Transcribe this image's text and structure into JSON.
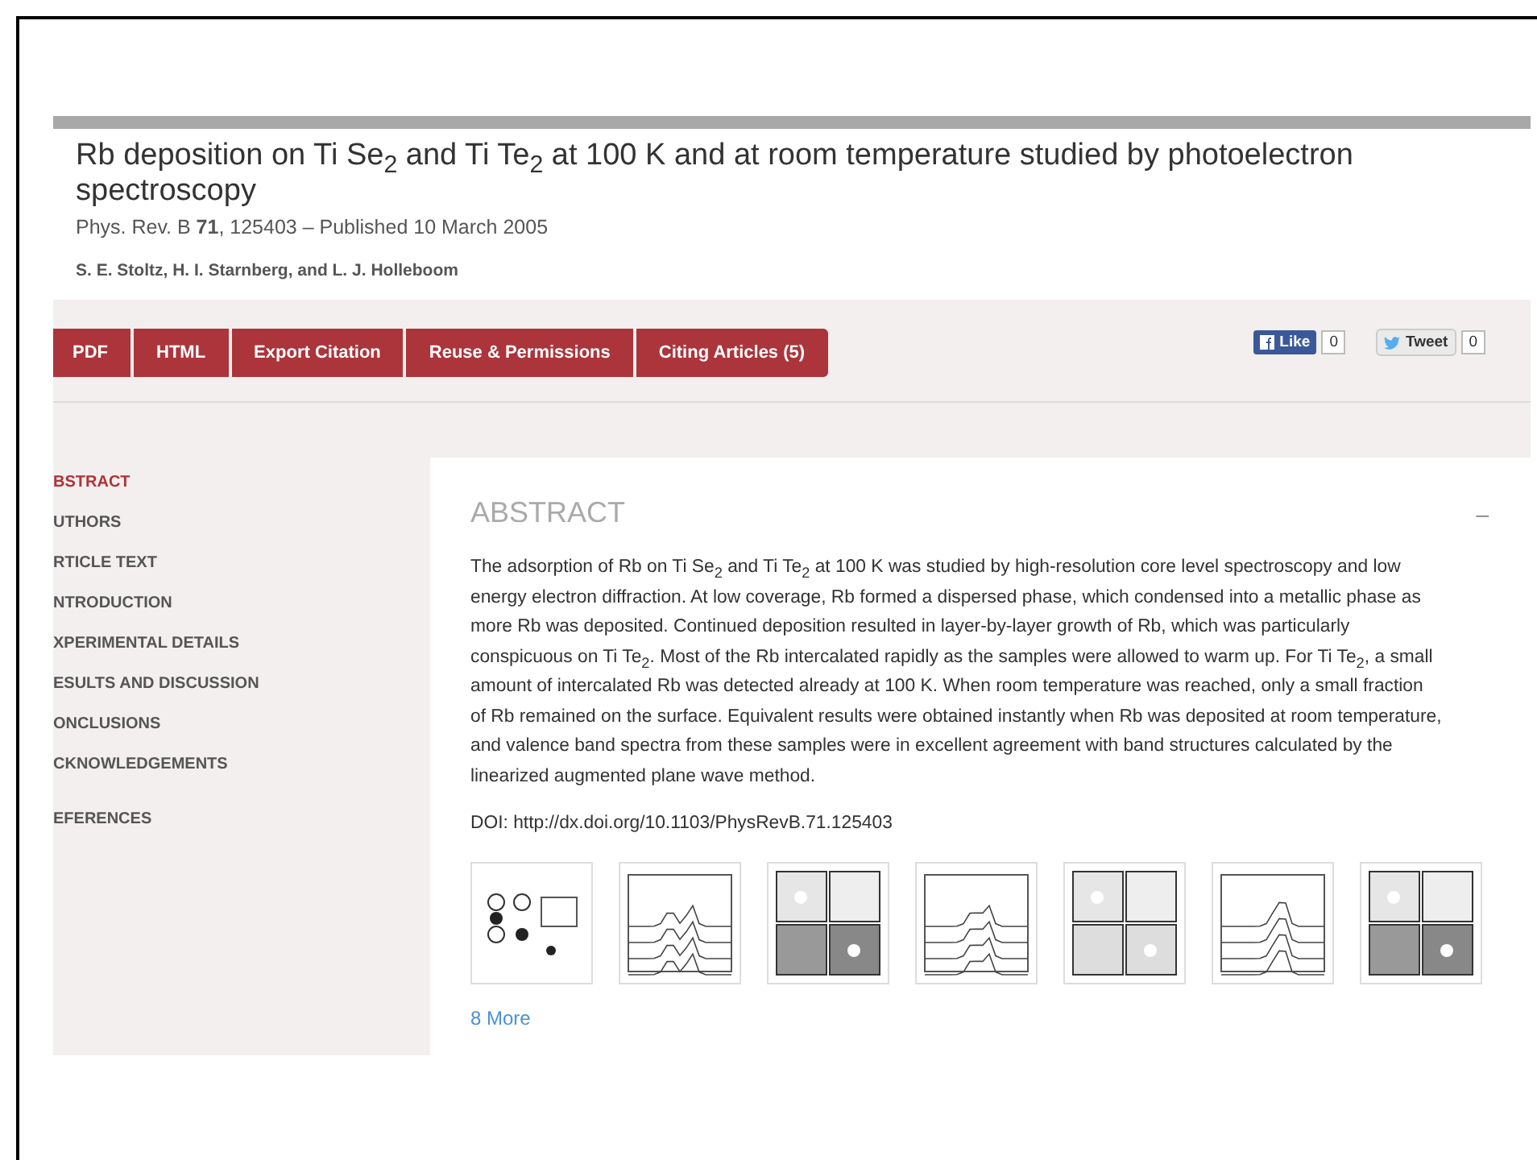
{
  "article": {
    "title": "Rb deposition on Ti Se$_{2}$ and Ti Te$_{2}$ at 100 K and at room temperature studied by photoelectron spectroscopy",
    "citation": "Phys. Rev. B **71**, 125403 – Published 10 March 2005",
    "authors": "S. E. Stoltz, H. I. Starnberg, and L. J. Holleboom"
  },
  "toolbar": {
    "buttons": [
      "PDF",
      "HTML",
      "Export Citation",
      "Reuse & Permissions",
      "Citing Articles (5)"
    ],
    "social": [
      {
        "kind": "like",
        "label": "Like",
        "count": "0"
      },
      {
        "kind": "tweet",
        "label": "Tweet",
        "count": "0"
      }
    ]
  },
  "sidebar": {
    "items": [
      {
        "label": "BSTRACT",
        "selected": true
      },
      {
        "label": "UTHORS",
        "selected": false
      },
      {
        "label": "RTICLE TEXT",
        "selected": false
      },
      {
        "label": "NTRODUCTION",
        "selected": false
      },
      {
        "label": "XPERIMENTAL DETAILS",
        "selected": false
      },
      {
        "label": "ESULTS AND DISCUSSION",
        "selected": false
      },
      {
        "label": "ONCLUSIONS",
        "selected": false
      },
      {
        "label": "CKNOWLEDGEMENTS",
        "selected": false
      },
      {
        "label": "EFERENCES",
        "selected": false
      }
    ]
  },
  "abstract": {
    "heading": "ABSTRACT",
    "collapse": "–",
    "text": "The adsorption of Rb on Ti Se$_{2}$ and Ti Te$_{2}$ at 100 K was studied by high-resolution core level spectroscopy and low energy electron diffraction. At low coverage, Rb formed a dispersed phase, which condensed into a metallic phase as more Rb was deposited. Continued deposition resulted in layer-by-layer growth of Rb, which was particularly conspicuous on Ti Te$_{2}$. Most of the Rb intercalated rapidly as the samples were allowed to warm up. For Ti Te$_{2}$, a small amount of intercalated Rb was detected already at 100 K. When room temperature was reached, only a small fraction of Rb remained on the surface. Equivalent results were obtained instantly when Rb was deposited at room temperature, and valence band spectra from these samples were in excellent agreement with band structures calculated by the linearized augmented plane wave method.",
    "doi": "DOI: http://dx.doi.org/10.1103/PhysRevB.71.125403",
    "more": "8 More"
  }
}
